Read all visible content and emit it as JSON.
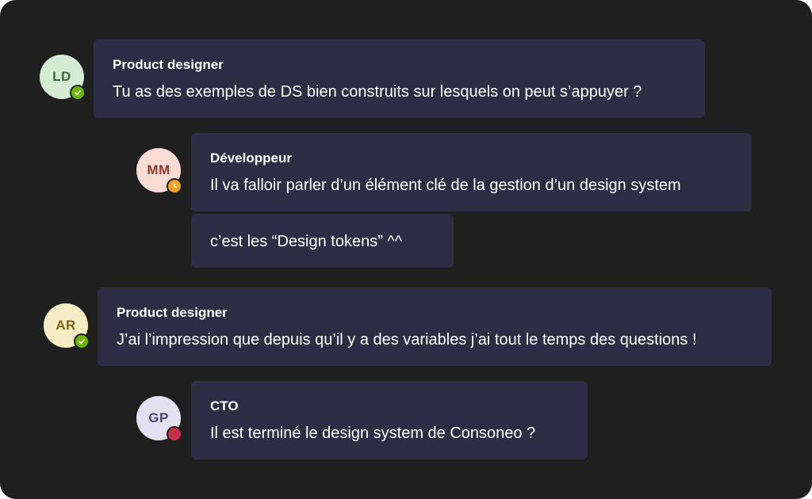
{
  "messages": [
    {
      "initials": "LD",
      "avatar_bg": "#d5ecd4",
      "avatar_fg": "#3e6b3a",
      "presence": "available",
      "presence_color": "#6bb700",
      "presence_icon": "check-icon",
      "author": "Product designer",
      "text": "Tu as des exemples de DS bien construits sur lesquels on peut s’appuyer ?"
    },
    {
      "initials": "MM",
      "avatar_bg": "#fbdcd4",
      "avatar_fg": "#8a3a2c",
      "presence": "away",
      "presence_color": "#f8a229",
      "presence_icon": "clock-icon",
      "author": "Développeur",
      "text": "Il va falloir parler d’un élément clé de la gestion d’un design system",
      "followup": "c’est les “Design tokens” ^^"
    },
    {
      "initials": "AR",
      "avatar_bg": "#f6edc4",
      "avatar_fg": "#7c6212",
      "presence": "available",
      "presence_color": "#6bb700",
      "presence_icon": "check-icon",
      "author": "Product designer",
      "text": "J’ai l’impression que depuis qu’il y a des variables j’ai tout le temps des questions !"
    },
    {
      "initials": "GP",
      "avatar_bg": "#e3e0f1",
      "avatar_fg": "#4a4670",
      "presence": "busy",
      "presence_color": "#c4314b",
      "presence_icon": "busy-dot-icon",
      "author": "CTO",
      "text": "Il est terminé le design system de Consoneo ?"
    }
  ],
  "colors": {
    "background": "#1f1f1f",
    "bubble": "#2e2d45",
    "text": "#ffffff"
  }
}
